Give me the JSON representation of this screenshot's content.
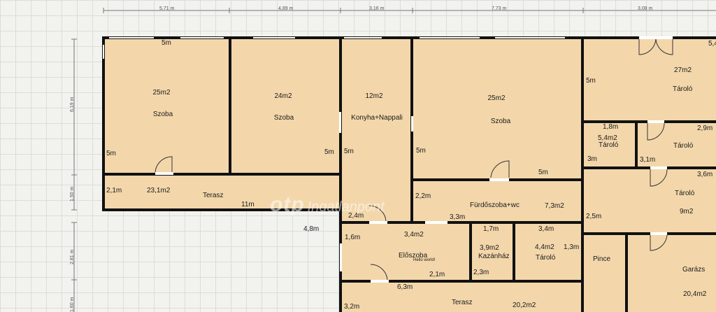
{
  "top_dimensions": [
    "5,71 m",
    "4,89 m",
    "3,16 m",
    "7,73 m",
    "3,08 m"
  ],
  "left_dimensions": [
    "6,19 m",
    "1,50 m",
    "2,81 m",
    "1,60 m"
  ],
  "rooms": {
    "szoba1": {
      "area": "25m2",
      "name": "Szoba",
      "top_wall": "5m",
      "left_wall": "5m"
    },
    "szoba2": {
      "area": "24m2",
      "name": "Szoba",
      "right_wall": "5m"
    },
    "konyha": {
      "area": "12m2",
      "name": "Konyha+Nappali",
      "left_wall": "5m"
    },
    "szoba3": {
      "area": "25m2",
      "name": "Szoba",
      "left_wall": "5m",
      "bottom_wall": "5m"
    },
    "terasz1": {
      "area": "23,1m2",
      "name": "Terasz",
      "side": "2,1m",
      "length": "11m"
    },
    "furdo": {
      "area": "7,3m2",
      "name": "Fürdőszoba+wc",
      "side": "2,2m",
      "bottom": "3,3m"
    },
    "eloszoba": {
      "area": "3,4m2",
      "name": "Előszoba",
      "side": "1,6m",
      "bottom": "2,1m",
      "top": "2,4m",
      "note": "Hello world!"
    },
    "kazanhaz": {
      "area": "3,9m2",
      "name": "Kazánház",
      "top": "1,7m",
      "side": "2,3m"
    },
    "tarolo_small": {
      "area": "4,4m2",
      "name": "Tároló",
      "top": "3,4m",
      "side": "1,3m"
    },
    "pince": {
      "name": "Pince"
    },
    "terasz2": {
      "area": "20,2m2",
      "name": "Terasz",
      "top": "6,3m",
      "side": "3,2m"
    },
    "tarolo_big": {
      "area": "27m2",
      "name": "Tároló",
      "left_wall": "5m",
      "corner": "5,4"
    },
    "tarolo_54": {
      "area": "5,4m2",
      "name": "Tároló",
      "top": "1,8m",
      "side": "3m"
    },
    "tarolo_29": {
      "name": "Tároló",
      "top": "2,9m",
      "side": "3,1m"
    },
    "tarolo_9": {
      "area": "9m2",
      "name": "Tároló",
      "top": "3,6m",
      "side": "2,5m"
    },
    "garazs": {
      "area": "20,4m2",
      "name": "Garázs"
    }
  },
  "outside": {
    "label": "4,8m"
  },
  "watermark": {
    "brand": "otp",
    "sub": "Ingatlanpont"
  }
}
